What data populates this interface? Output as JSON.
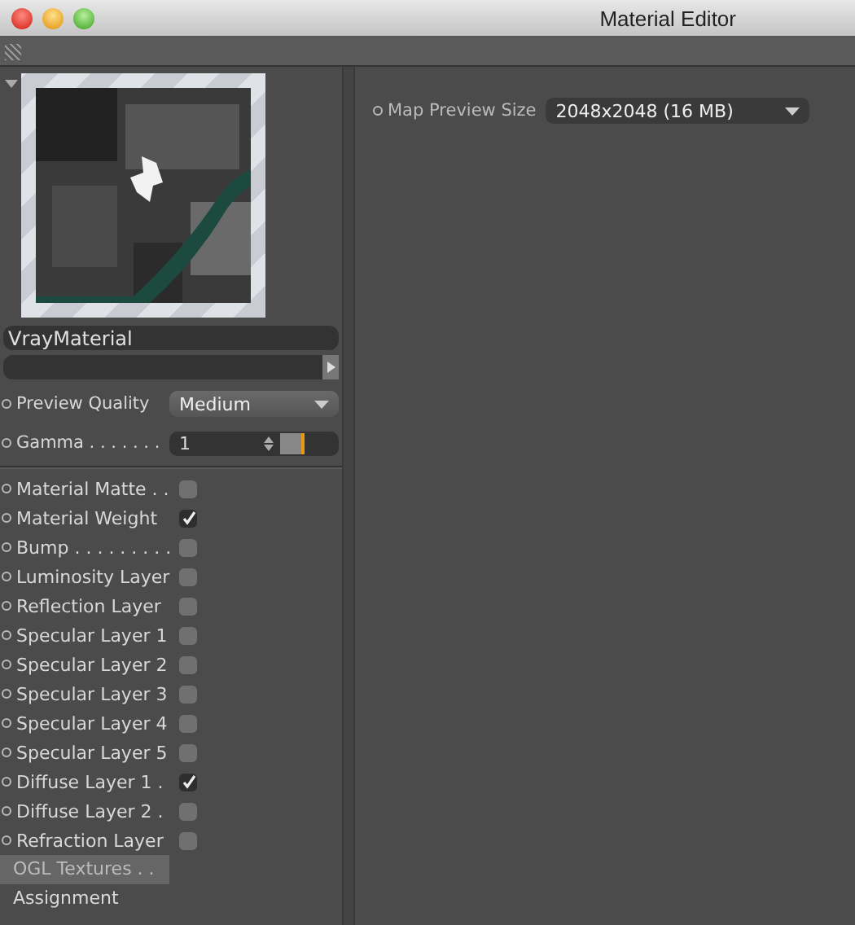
{
  "window": {
    "title": "Material Editor"
  },
  "material_name": "VrayMaterial",
  "preview_quality": {
    "label": "Preview Quality",
    "value": "Medium"
  },
  "gamma": {
    "label": "Gamma . . . . . . .",
    "value": "1",
    "level": 0.45
  },
  "channels": [
    {
      "label": "Material Matte . .",
      "checked": false
    },
    {
      "label": "Material Weight",
      "checked": true
    },
    {
      "label": "Bump . . . . . . . . .",
      "checked": false
    },
    {
      "label": "Luminosity Layer",
      "checked": false
    },
    {
      "label": "Reflection Layer",
      "checked": false
    },
    {
      "label": "Specular Layer 1",
      "checked": false
    },
    {
      "label": "Specular Layer 2",
      "checked": false
    },
    {
      "label": "Specular Layer 3",
      "checked": false
    },
    {
      "label": "Specular Layer 4",
      "checked": false
    },
    {
      "label": "Specular Layer 5",
      "checked": false
    },
    {
      "label": "Diffuse Layer 1 .",
      "checked": true
    },
    {
      "label": "Diffuse Layer 2 .",
      "checked": false
    },
    {
      "label": "Refraction Layer",
      "checked": false
    }
  ],
  "pages": [
    {
      "label": "OGL Textures . .",
      "selected": true
    },
    {
      "label": "Assignment",
      "selected": false
    }
  ],
  "map_preview_size": {
    "label": "Map Preview Size",
    "value": "2048x2048 (16 MB)"
  }
}
